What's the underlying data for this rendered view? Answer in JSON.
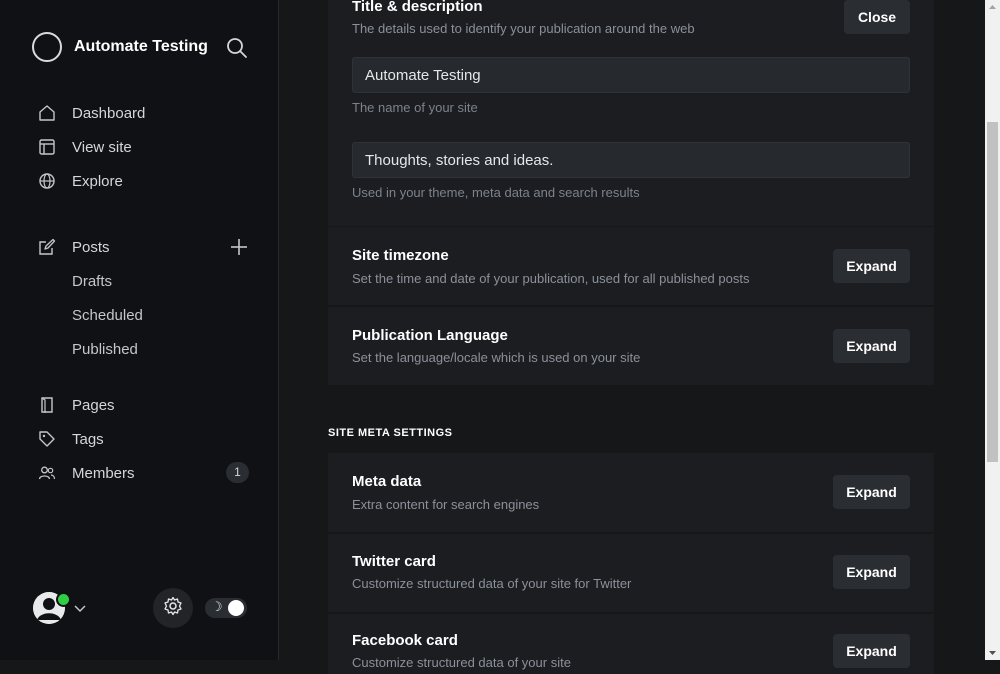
{
  "brand": {
    "name": "Automate Testing"
  },
  "nav": {
    "dashboard": "Dashboard",
    "view_site": "View site",
    "explore": "Explore",
    "posts": "Posts",
    "drafts": "Drafts",
    "scheduled": "Scheduled",
    "published": "Published",
    "pages": "Pages",
    "tags": "Tags",
    "members": "Members",
    "members_count": "1"
  },
  "footer": {
    "theme_icon": "moon-icon",
    "settings_icon": "gear-icon"
  },
  "title_card": {
    "title": "Title & description",
    "desc": "The details used to identify your publication around the web",
    "close_label": "Close",
    "site_title_value": "Automate Testing",
    "site_title_hint": "The name of your site",
    "site_desc_value": "Thoughts, stories and ideas.",
    "site_desc_hint": "Used in your theme, meta data and search results"
  },
  "timezone": {
    "title": "Site timezone",
    "desc": "Set the time and date of your publication, used for all published posts",
    "button": "Expand"
  },
  "language": {
    "title": "Publication Language",
    "desc": "Set the language/locale which is used on your site",
    "button": "Expand"
  },
  "meta_section": {
    "heading": "SITE META SETTINGS"
  },
  "meta_data": {
    "title": "Meta data",
    "desc": "Extra content for search engines",
    "button": "Expand"
  },
  "twitter": {
    "title": "Twitter card",
    "desc": "Customize structured data of your site for Twitter",
    "button": "Expand"
  },
  "facebook": {
    "title": "Facebook card",
    "desc": "Customize structured data of your site",
    "button": "Expand"
  },
  "colors": {
    "sidebar_bg": "#0f1114",
    "main_bg": "#151719",
    "card_bg": "#1b1d21",
    "online": "#30cf43"
  }
}
